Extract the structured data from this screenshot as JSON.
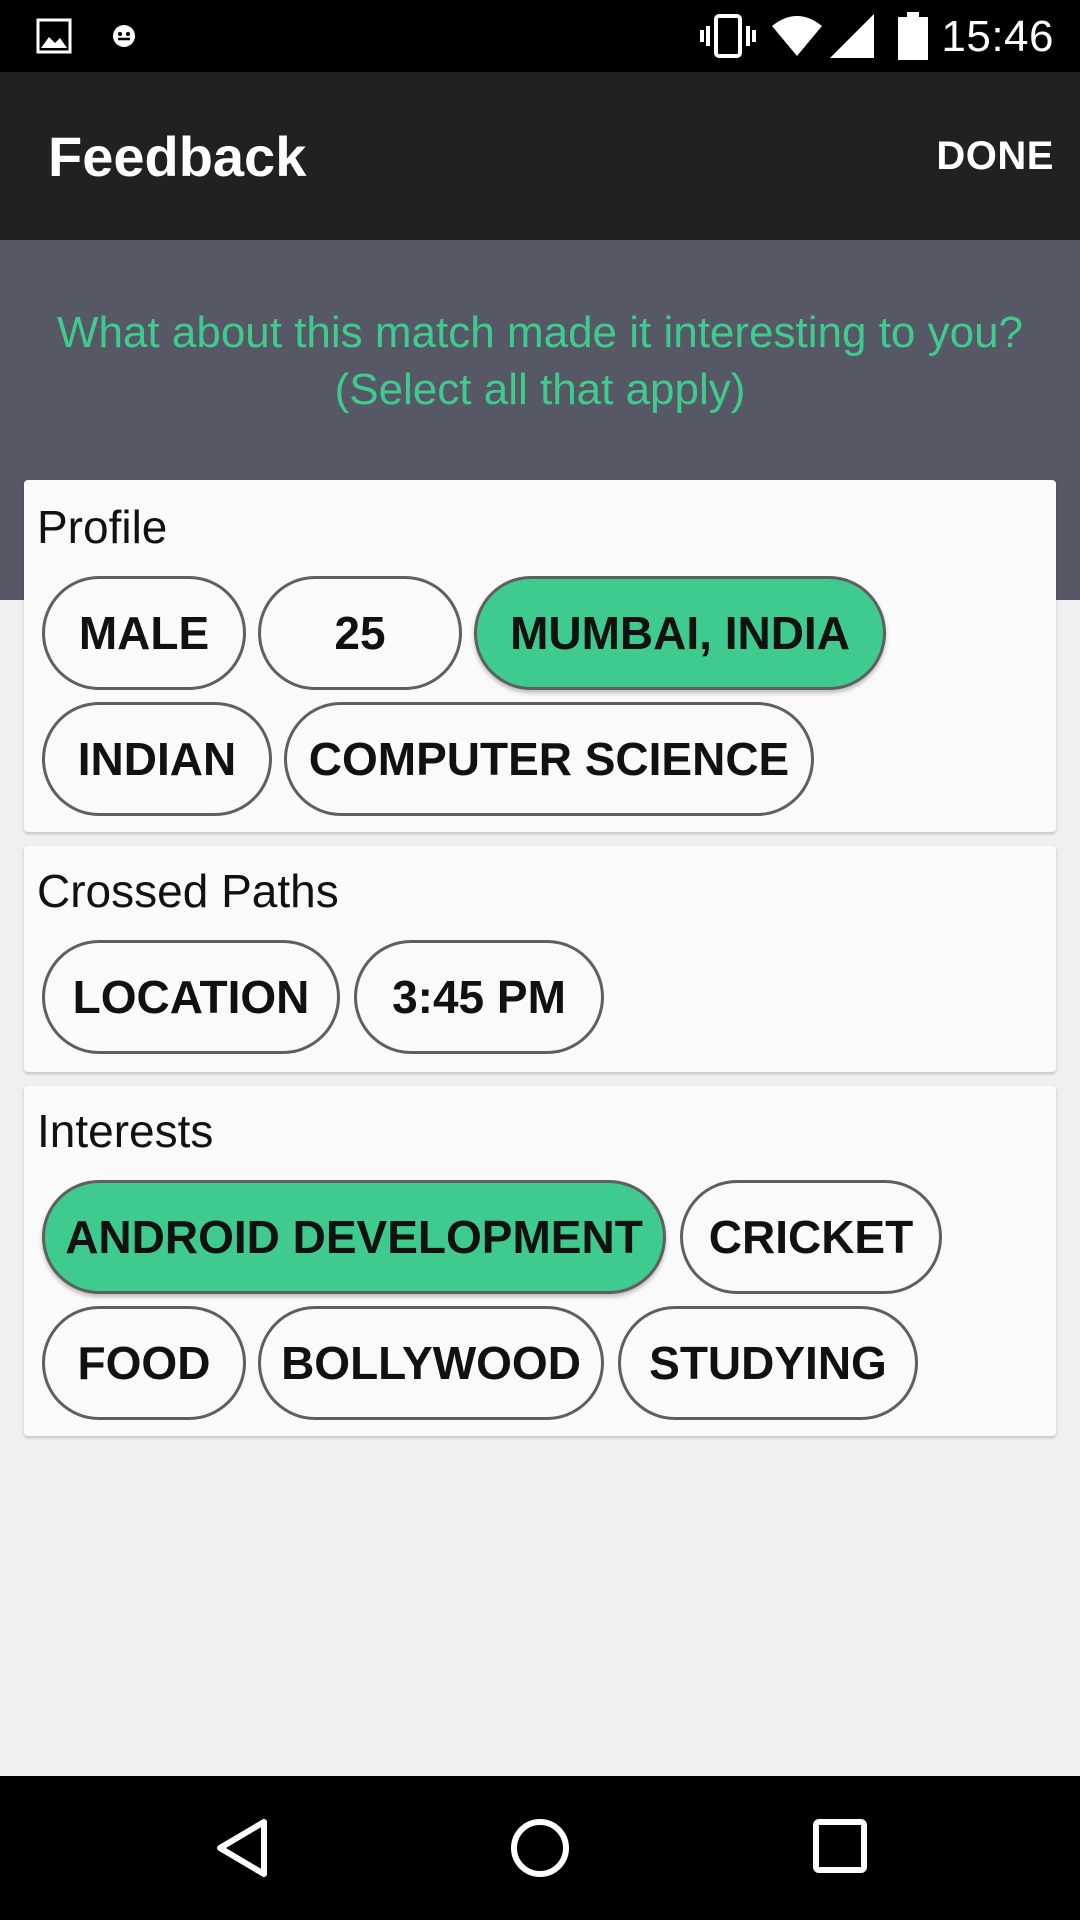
{
  "status_bar": {
    "time": "15:46",
    "icons": [
      "image-notification-icon",
      "emoji-notification-icon",
      "vibrate-icon",
      "wifi-icon",
      "signal-icon",
      "battery-icon"
    ]
  },
  "toolbar": {
    "title": "Feedback",
    "action_label": "DONE"
  },
  "prompt": "What about this match made it interesting to you? (Select all that apply)",
  "sections": [
    {
      "title": "Profile",
      "chips": [
        {
          "label": "MALE",
          "selected": false
        },
        {
          "label": "25",
          "selected": false
        },
        {
          "label": "MUMBAI, INDIA",
          "selected": true
        },
        {
          "label": "INDIAN",
          "selected": false
        },
        {
          "label": "COMPUTER SCIENCE",
          "selected": false
        }
      ]
    },
    {
      "title": "Crossed Paths",
      "chips": [
        {
          "label": "LOCATION",
          "selected": false
        },
        {
          "label": "3:45 PM",
          "selected": false
        }
      ]
    },
    {
      "title": "Interests",
      "chips": [
        {
          "label": "ANDROID DEVELOPMENT",
          "selected": true
        },
        {
          "label": "CRICKET",
          "selected": false
        },
        {
          "label": "FOOD",
          "selected": false
        },
        {
          "label": "BOLLYWOOD",
          "selected": false
        },
        {
          "label": "STUDYING",
          "selected": false
        }
      ]
    }
  ],
  "nav_bar": {
    "buttons": [
      "back-icon",
      "home-icon",
      "recents-icon"
    ]
  },
  "colors": {
    "accent": "#3ecb8d",
    "header_band": "#565865",
    "toolbar": "#212121",
    "background": "#efefef",
    "card": "#fafafa"
  }
}
